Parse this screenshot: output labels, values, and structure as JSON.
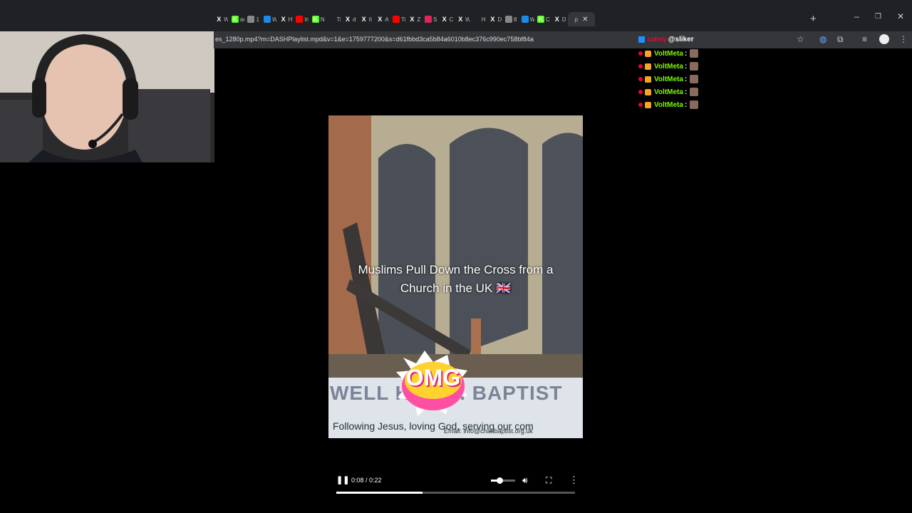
{
  "browser": {
    "tabs": [
      {
        "icon": "X",
        "title": "W",
        "color": "#202124"
      },
      {
        "icon": "K",
        "title": "ar",
        "color": "#53fc18"
      },
      {
        "icon": "globe",
        "title": "1",
        "color": "#888888"
      },
      {
        "icon": "oo",
        "title": "W",
        "color": "#1e88e5"
      },
      {
        "icon": "X",
        "title": "H",
        "color": "#202124"
      },
      {
        "icon": "yt",
        "title": "In",
        "color": "#ff0000"
      },
      {
        "icon": "K",
        "title": "N",
        "color": "#53fc18"
      },
      {
        "icon": "tt",
        "title": "Ti",
        "color": "#202124"
      },
      {
        "icon": "X",
        "title": "d",
        "color": "#202124"
      },
      {
        "icon": "X",
        "title": "II",
        "color": "#202124"
      },
      {
        "icon": "X",
        "title": "A",
        "color": "#202124"
      },
      {
        "icon": "yt",
        "title": "Ti",
        "color": "#ff0000"
      },
      {
        "icon": "X",
        "title": "Z",
        "color": "#202124"
      },
      {
        "icon": "dot",
        "title": "S",
        "color": "#e0245e"
      },
      {
        "icon": "X",
        "title": "C",
        "color": "#202124"
      },
      {
        "icon": "X",
        "title": "W",
        "color": "#202124"
      },
      {
        "icon": "tt",
        "title": "H",
        "color": "#202124"
      },
      {
        "icon": "X",
        "title": "D",
        "color": "#202124"
      },
      {
        "icon": "globe",
        "title": "8",
        "color": "#888888"
      },
      {
        "icon": "oo",
        "title": "W",
        "color": "#1e88e5"
      },
      {
        "icon": "K",
        "title": "C",
        "color": "#53fc18"
      },
      {
        "icon": "X",
        "title": "D",
        "color": "#202124"
      }
    ],
    "active_tab": {
      "title": "p",
      "close": "✕"
    },
    "new_tab": "+",
    "url": "es_1280p.mp4?m=DASHPlaylist.mpd&v=1&e=1759777200&s=d61fbbd3ca5b84a6010b8ec376c990ec758bf84a",
    "window": {
      "minimize": "–",
      "restore": "❐",
      "close": "✕"
    }
  },
  "chat": {
    "header": {
      "prefix": "zahey",
      "handle": "@sliker"
    },
    "lines": [
      {
        "user": "VoltMeta",
        "sep": ":"
      },
      {
        "user": "VoltMeta",
        "sep": ":"
      },
      {
        "user": "VoltMeta",
        "sep": ":"
      },
      {
        "user": "VoltMeta",
        "sep": ":"
      },
      {
        "user": "VoltMeta",
        "sep": ":"
      }
    ]
  },
  "video": {
    "caption_line1": "Muslims Pull Down the Cross from a",
    "caption_line2": "Church in the UK 🇬🇧",
    "sign_line1": "WELL HEATH BAPTIST",
    "sign_line2": "Following Jesus, loving God, serving our com",
    "sign_line3": "Email: info@chadbaptist.org.uk",
    "sticker": "OMG"
  },
  "player": {
    "time": "0:08 / 0:22",
    "progress": 0.36,
    "volume": 0.35
  }
}
